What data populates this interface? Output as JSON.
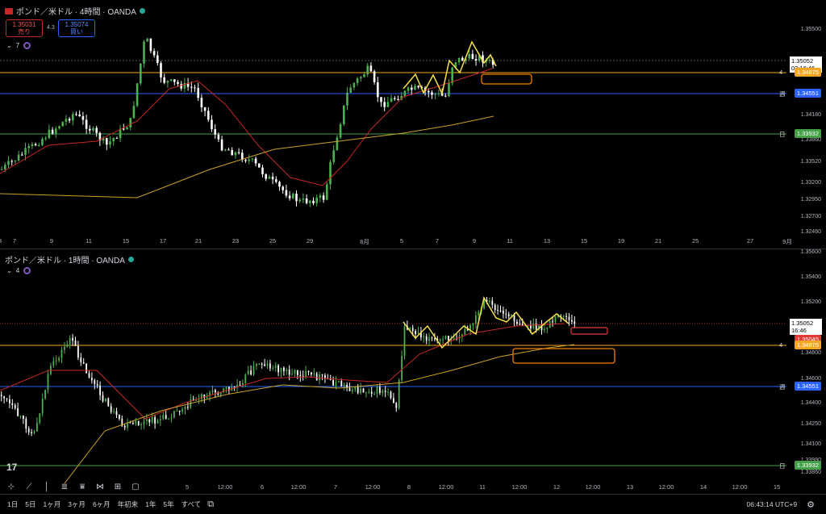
{
  "top": {
    "title": "ポンド／米ドル · 4時間 · OANDA",
    "sell_price": "1.35031",
    "sell_label": "売り",
    "spread": "4.3",
    "buy_price": "1.35074",
    "buy_label": "買い",
    "indicator_count": "7",
    "y_ticks": [
      "1.35500",
      "1.34840",
      "1.34180",
      "1.33860",
      "1.33520",
      "1.33200",
      "1.32950",
      "1.32700",
      "1.32460"
    ],
    "x_ticks": [
      "7",
      "9",
      "11",
      "15",
      "17",
      "21",
      "23",
      "25",
      "29",
      "8月",
      "5",
      "7",
      "9",
      "11",
      "13",
      "15",
      "19",
      "21",
      "25",
      "27",
      "9月",
      "3"
    ],
    "current_price": "1.35052",
    "countdown": "03:16:46",
    "lines": [
      {
        "label": "4",
        "value": "1.34875",
        "color": "#f5a623"
      },
      {
        "label": "週",
        "value": "1.34551",
        "color": "#2962ff"
      },
      {
        "label": "日",
        "value": "1.33932",
        "color": "#43a047"
      }
    ]
  },
  "bottom": {
    "title": "ポンド／米ドル · 1時間 · OANDA",
    "indicator_count": "4",
    "y_ticks": [
      "1.35600",
      "1.35400",
      "1.35200",
      "1.34800",
      "1.34600",
      "1.34400",
      "1.34250",
      "1.34100",
      "1.33980",
      "1.33860"
    ],
    "x_ticks": [
      "5",
      "12:00",
      "6",
      "12:00",
      "7",
      "12:00",
      "8",
      "12:00",
      "11",
      "12:00",
      "12",
      "12:00",
      "13",
      "12:00",
      "14",
      "12:00",
      "15"
    ],
    "current_price": "1.35052",
    "countdown": "16:46",
    "bid_price": "1.35045",
    "lines": [
      {
        "label": "4",
        "value": "1.34875",
        "color": "#f5a623"
      },
      {
        "label": "週",
        "value": "1.34551",
        "color": "#2962ff"
      },
      {
        "label": "日",
        "value": "1.33932",
        "color": "#43a047"
      }
    ]
  },
  "range_buttons": [
    "1日",
    "5日",
    "1ヶ月",
    "3ヶ月",
    "6ヶ月",
    "年初来",
    "1年",
    "5年",
    "すべて"
  ],
  "clock": "06:43:14 UTC+9",
  "logo": "17",
  "colors": {
    "up": "#4caf50",
    "down": "#ffffff",
    "ma_red": "#c62828",
    "ma_yellow": "#c9a227",
    "zigzag": "#f5e04b",
    "bg": "#000000"
  }
}
